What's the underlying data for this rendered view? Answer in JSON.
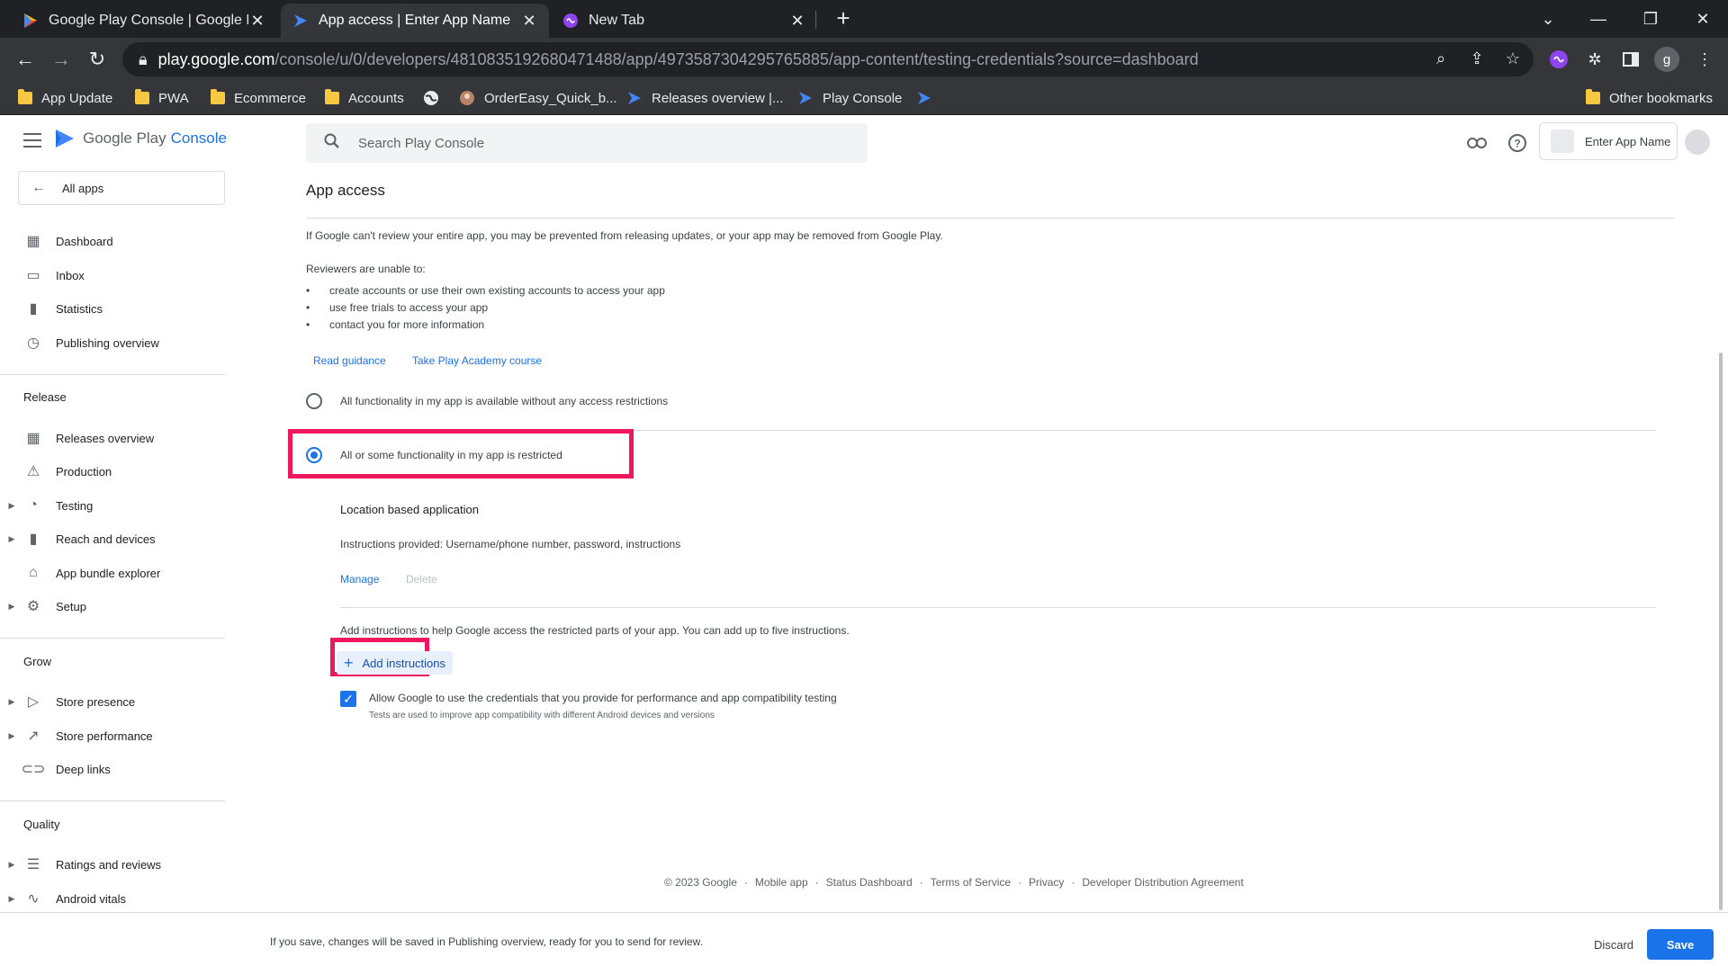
{
  "browser": {
    "tabs": [
      {
        "title": "Google Play Console | Google Pl",
        "active": false
      },
      {
        "title": "App access | Enter App Name",
        "active": true
      },
      {
        "title": "New Tab",
        "active": false
      }
    ],
    "url": {
      "host": "play.google.com",
      "path": "/console/u/0/developers/4810835192680471488/app/4973587304295765885/app-content/testing-credentials?source=dashboard"
    },
    "bookmarks": [
      {
        "label": "App Update",
        "icon": "folder-icon"
      },
      {
        "label": "PWA",
        "icon": "folder-icon"
      },
      {
        "label": "Ecommerce",
        "icon": "folder-icon"
      },
      {
        "label": "Accounts",
        "icon": "folder-icon"
      },
      {
        "label": "",
        "icon": "globe-icon"
      },
      {
        "label": "OrderEasy_Quick_b...",
        "icon": "avatar-icon"
      },
      {
        "label": "Releases overview |...",
        "icon": "play-console-icon"
      },
      {
        "label": "Play Console",
        "icon": "play-console-icon"
      },
      {
        "label": "",
        "icon": "play-console-icon"
      }
    ],
    "other_bookmarks": "Other bookmarks",
    "profile_initial": "g"
  },
  "header": {
    "logo_google_play": "Google Play",
    "logo_console": "Console",
    "search_placeholder": "Search Play Console",
    "app_name": "Enter App Name"
  },
  "sidebar": {
    "all_apps": "All apps",
    "top_items": [
      {
        "label": "Dashboard",
        "icon": "dashboard-icon"
      },
      {
        "label": "Inbox",
        "icon": "inbox-icon"
      },
      {
        "label": "Statistics",
        "icon": "statistics-icon"
      },
      {
        "label": "Publishing overview",
        "icon": "publishing-overview-icon"
      }
    ],
    "release_title": "Release",
    "release_items": [
      {
        "label": "Releases overview",
        "icon": "releases-overview-icon"
      },
      {
        "label": "Production",
        "icon": "production-icon"
      },
      {
        "label": "Testing",
        "icon": "testing-icon"
      },
      {
        "label": "Reach and devices",
        "icon": "reach-devices-icon"
      },
      {
        "label": "App bundle explorer",
        "icon": "app-bundle-icon"
      },
      {
        "label": "Setup",
        "icon": "setup-gear-icon"
      }
    ],
    "grow_title": "Grow",
    "grow_items": [
      {
        "label": "Store presence",
        "icon": "store-presence-icon"
      },
      {
        "label": "Store performance",
        "icon": "store-performance-icon"
      },
      {
        "label": "Deep links",
        "icon": "deep-links-icon"
      }
    ],
    "quality_title": "Quality",
    "quality_items": [
      {
        "label": "Ratings and reviews",
        "icon": "ratings-reviews-icon"
      },
      {
        "label": "Android vitals",
        "icon": "android-vitals-icon"
      }
    ]
  },
  "content": {
    "title": "App access",
    "intro": "If Google can't review your entire app, you may be prevented from releasing updates, or your app may be removed from Google Play.",
    "reviewers_heading": "Reviewers are unable to:",
    "bullets": [
      "create accounts or use their own existing accounts to access your app",
      "use free trials to access your app",
      "contact you for more information"
    ],
    "read_guidance": "Read guidance",
    "academy_course": "Take Play Academy course",
    "option_all": "All functionality in my app is available without any access restrictions",
    "option_restricted": "All or some functionality in my app is restricted",
    "selected_option": "restricted",
    "instruction_name": "Location based application",
    "instruction_provided": "Instructions provided: Username/phone number, password, instructions",
    "manage": "Manage",
    "delete": "Delete",
    "add_help": "Add instructions to help Google access the restricted parts of your app. You can add up to five instructions.",
    "add_instructions": "Add instructions",
    "allow_credentials": "Allow Google to use the credentials that you provide for performance and app compatibility testing",
    "allow_credentials_checked": true,
    "tests_note": "Tests are used to improve app compatibility with different Android devices and versions"
  },
  "footer": {
    "copyright": "© 2023 Google",
    "links": [
      "Mobile app",
      "Status Dashboard",
      "Terms of Service",
      "Privacy",
      "Developer Distribution Agreement"
    ]
  },
  "bottom_bar": {
    "message": "If you save, changes will be saved in Publishing overview, ready for you to send for review.",
    "discard": "Discard",
    "save": "Save"
  },
  "colors": {
    "accent": "#1a73e8",
    "highlight": "#f0185c"
  }
}
